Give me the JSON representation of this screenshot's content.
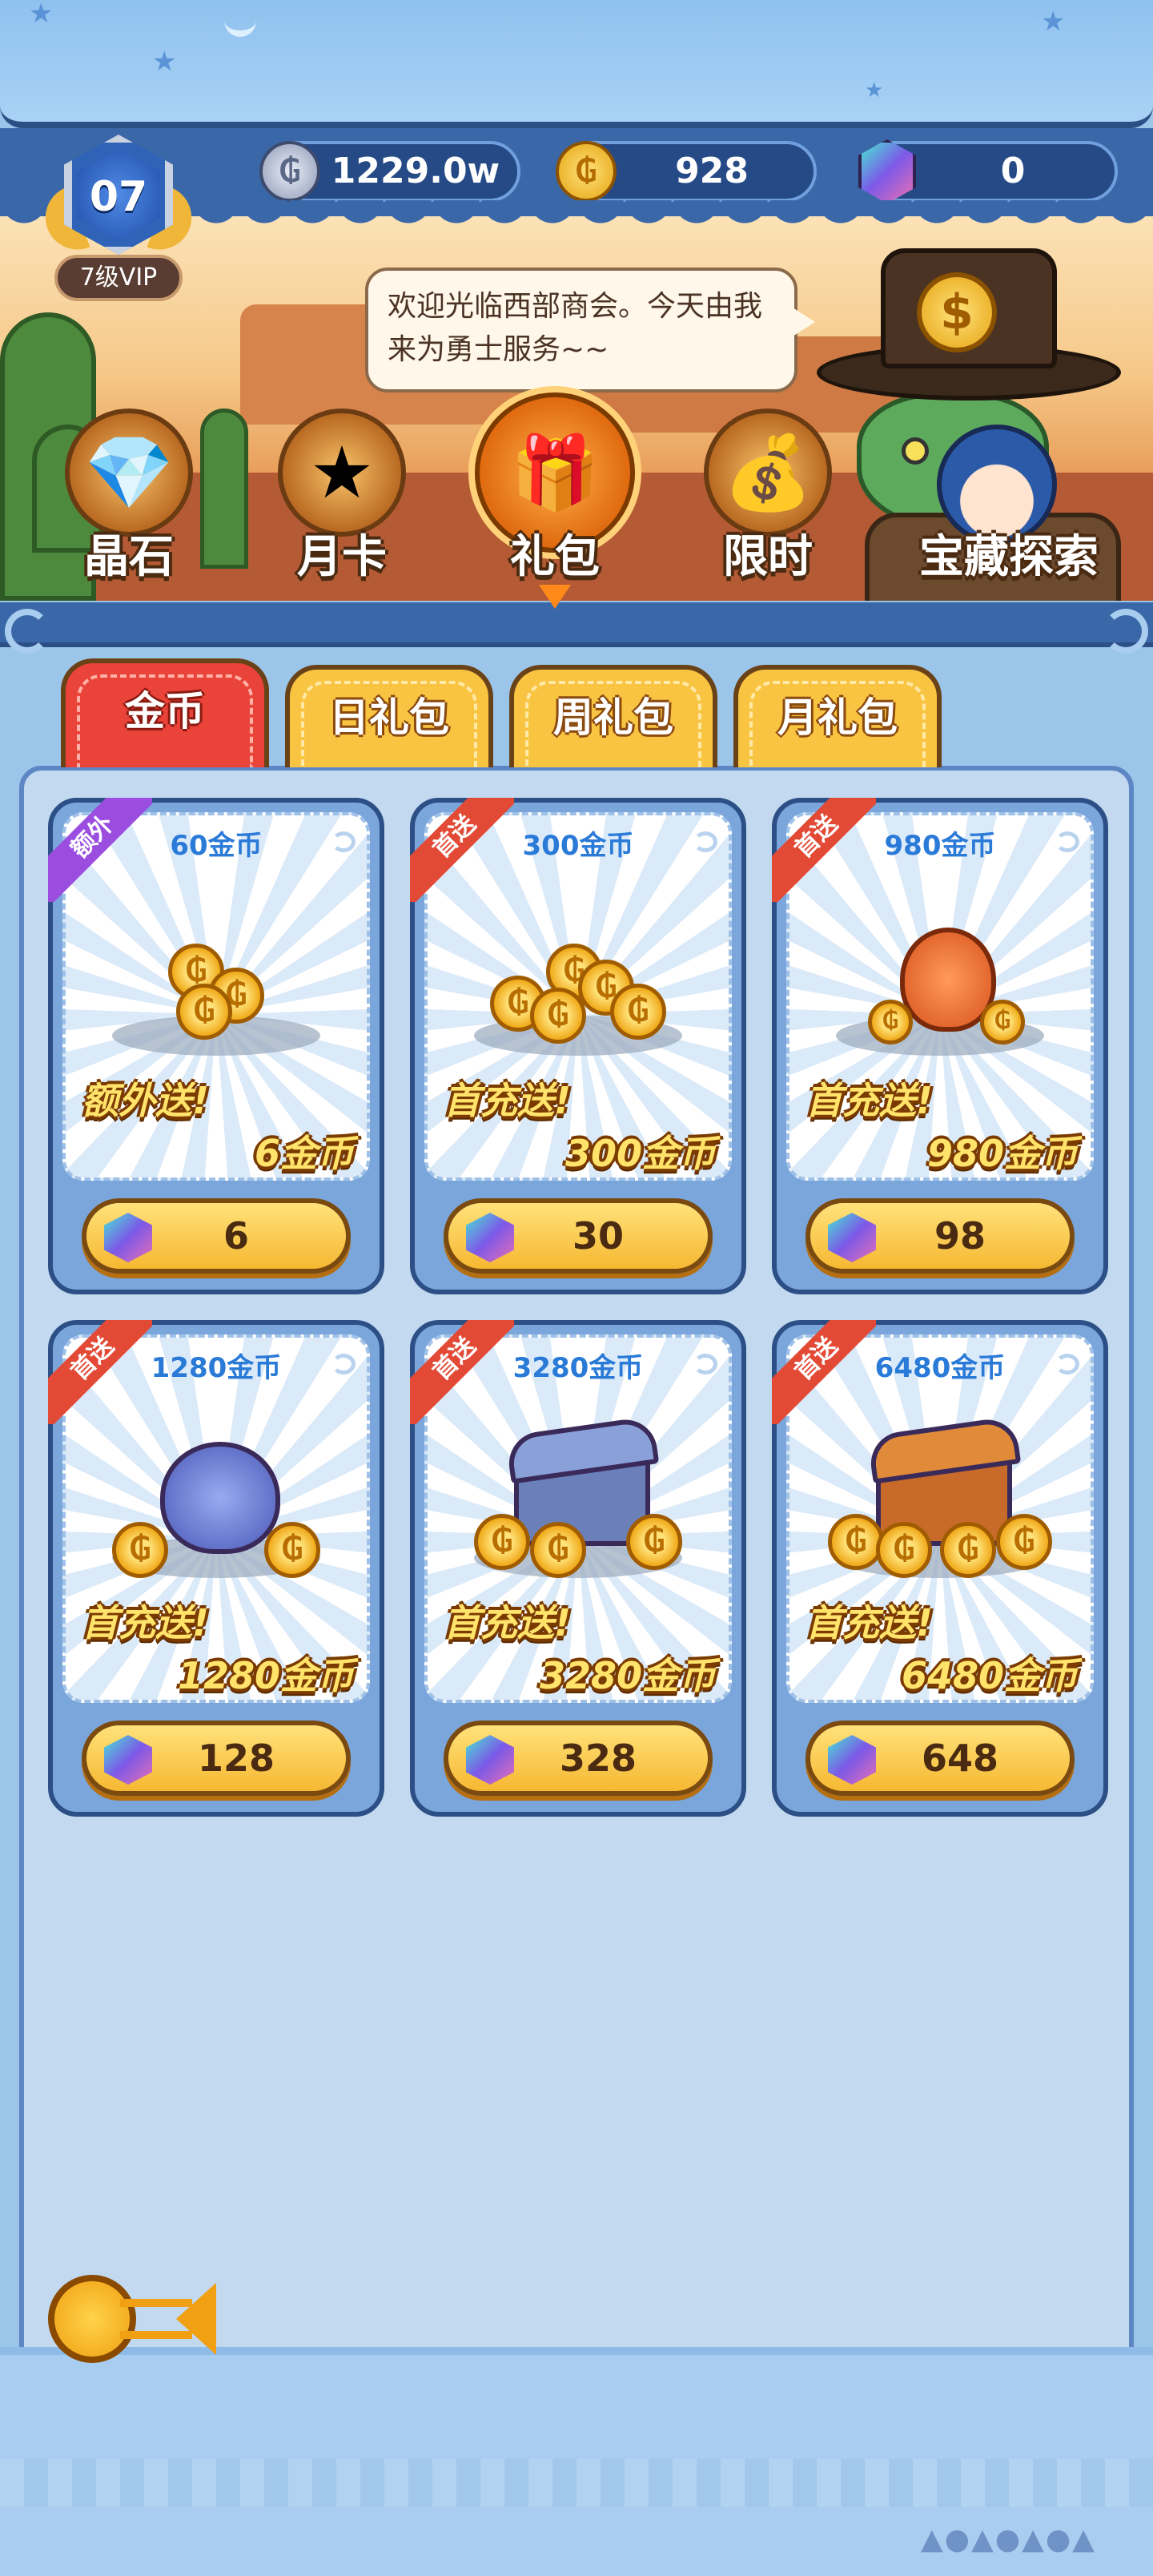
{
  "currency": {
    "silver": "1229.0w",
    "gold": "928",
    "gems": "0"
  },
  "vip": {
    "level": "07",
    "label": "7级VIP"
  },
  "npc": {
    "speech": "欢迎光临西部商会。今天由我来为勇士服务~~"
  },
  "categories": [
    {
      "label": "晶石",
      "icon": "crystal-icon"
    },
    {
      "label": "月卡",
      "icon": "monthly-card-icon"
    },
    {
      "label": "礼包",
      "icon": "gift-box-icon",
      "active": true
    },
    {
      "label": "限时",
      "icon": "limited-time-bag-icon"
    },
    {
      "label": "宝藏探索",
      "icon": "treasure-explore-icon"
    }
  ],
  "tabs": [
    {
      "label": "金币",
      "active": true
    },
    {
      "label": "日礼包"
    },
    {
      "label": "周礼包"
    },
    {
      "label": "月礼包"
    }
  ],
  "products": [
    {
      "title": "60金币",
      "ribbon": "额外",
      "promo_line1": "额外送!",
      "promo_line2": "6金币",
      "price": "6"
    },
    {
      "title": "300金币",
      "ribbon": "首送",
      "promo_line1": "首充送!",
      "promo_line2": "300金币",
      "price": "30"
    },
    {
      "title": "980金币",
      "ribbon": "首送",
      "promo_line1": "首充送!",
      "promo_line2": "980金币",
      "price": "98"
    },
    {
      "title": "1280金币",
      "ribbon": "首送",
      "promo_line1": "首充送!",
      "promo_line2": "1280金币",
      "price": "128"
    },
    {
      "title": "3280金币",
      "ribbon": "首送",
      "promo_line1": "首充送!",
      "promo_line2": "3280金币",
      "price": "328"
    },
    {
      "title": "6480金币",
      "ribbon": "首送",
      "promo_line1": "首充送!",
      "promo_line2": "6480金币",
      "price": "648"
    }
  ],
  "colors": {
    "background": "#9cc5ea",
    "frame": "#2c4f86",
    "tab_active": "#e9433a",
    "tab_inactive": "#f9c441",
    "ribbon_first": "#e24a36",
    "ribbon_extra": "#9b4de0",
    "card_title": "#2a7ad8"
  }
}
